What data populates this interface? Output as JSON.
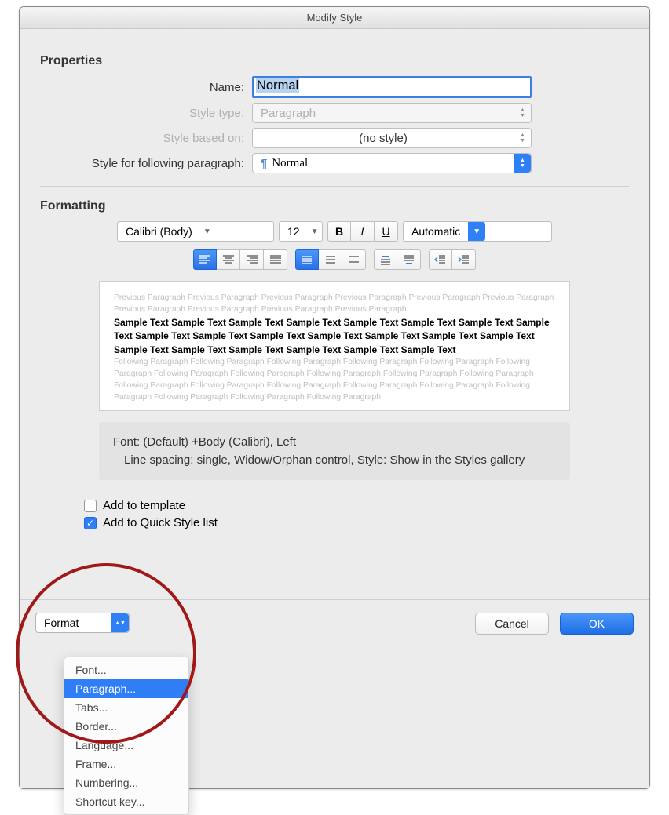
{
  "window": {
    "title": "Modify Style"
  },
  "properties": {
    "heading": "Properties",
    "name_label": "Name:",
    "name_value": "Normal",
    "type_label": "Style type:",
    "type_value": "Paragraph",
    "based_label": "Style based on:",
    "based_value": "(no style)",
    "following_label": "Style for following paragraph:",
    "following_value": "Normal"
  },
  "formatting": {
    "heading": "Formatting",
    "font_name": "Calibri (Body)",
    "font_size": "12",
    "bold": "B",
    "italic": "I",
    "underline": "U",
    "color": "Automatic"
  },
  "preview": {
    "prev": "Previous Paragraph Previous Paragraph Previous Paragraph Previous Paragraph Previous Paragraph Previous Paragraph Previous Paragraph Previous Paragraph Previous Paragraph Previous Paragraph",
    "sample": "Sample Text Sample Text Sample Text Sample Text Sample Text Sample Text Sample Text Sample Text Sample Text Sample Text Sample Text Sample Text Sample Text Sample Text Sample Text Sample Text Sample Text Sample Text Sample Text Sample Text Sample Text",
    "foll": "Following Paragraph Following Paragraph Following Paragraph Following Paragraph Following Paragraph Following Paragraph Following Paragraph Following Paragraph Following Paragraph Following Paragraph Following Paragraph Following Paragraph Following Paragraph Following Paragraph Following Paragraph Following Paragraph Following Paragraph Following Paragraph Following Paragraph Following Paragraph"
  },
  "description": {
    "line1": "Font: (Default) +Body (Calibri), Left",
    "line2": "Line spacing:  single, Widow/Orphan control, Style: Show in the Styles gallery"
  },
  "checks": {
    "template": "Add to template",
    "quick": "Add to Quick Style list"
  },
  "footer": {
    "format": "Format",
    "cancel": "Cancel",
    "ok": "OK"
  },
  "menu": {
    "items": [
      "Font...",
      "Paragraph...",
      "Tabs...",
      "Border...",
      "Language...",
      "Frame...",
      "Numbering...",
      "Shortcut key..."
    ],
    "selected_index": 1
  }
}
